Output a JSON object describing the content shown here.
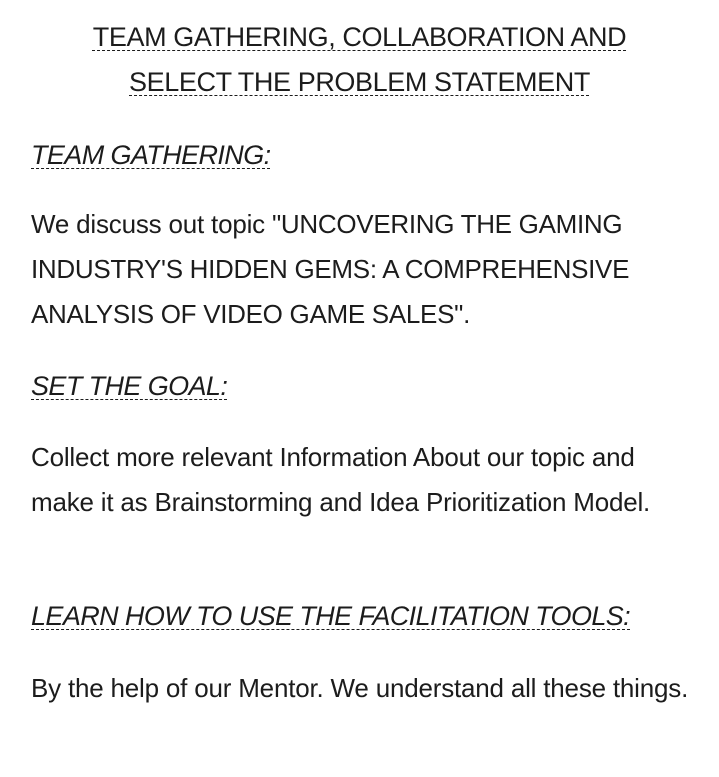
{
  "title": {
    "line1": "TEAM GATHERING, COLLABORATION AND",
    "line2": "SELECT THE PROBLEM STATEMENT"
  },
  "sections": [
    {
      "heading": "TEAM GATHERING:",
      "text_prefix": "We discuss out topic ",
      "text_quote": "\"UNCOVERING THE GAMING INDUSTRY'S HIDDEN GEMS: A COMPREHENSIVE ANALYSIS OF VIDEO GAME SALES\"."
    },
    {
      "heading": "SET THE GOAL:",
      "text": "Collect more relevant Information About our topic and make it as Brainstorming and Idea Prioritization Model."
    },
    {
      "heading": "LEARN HOW TO USE THE FACILITATION TOOLS:",
      "text": "By the help of our Mentor. We understand all these things."
    }
  ]
}
